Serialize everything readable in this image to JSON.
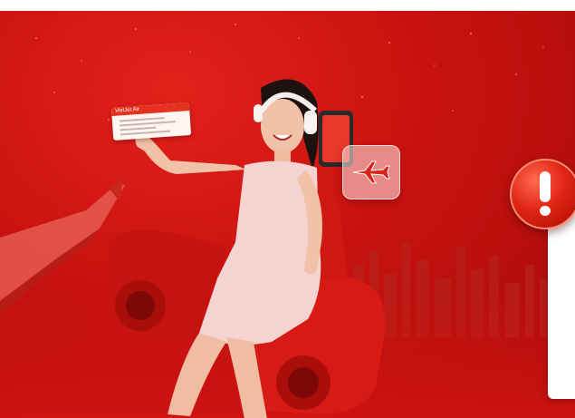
{
  "banner": {
    "ticket_brand": "VietJet Air",
    "colors": {
      "primary": "#d3140f",
      "dark": "#a60b0a",
      "accent_white": "#ffffff"
    }
  },
  "icons": {
    "plane": "airplane-icon",
    "warning": "exclamation-icon"
  }
}
